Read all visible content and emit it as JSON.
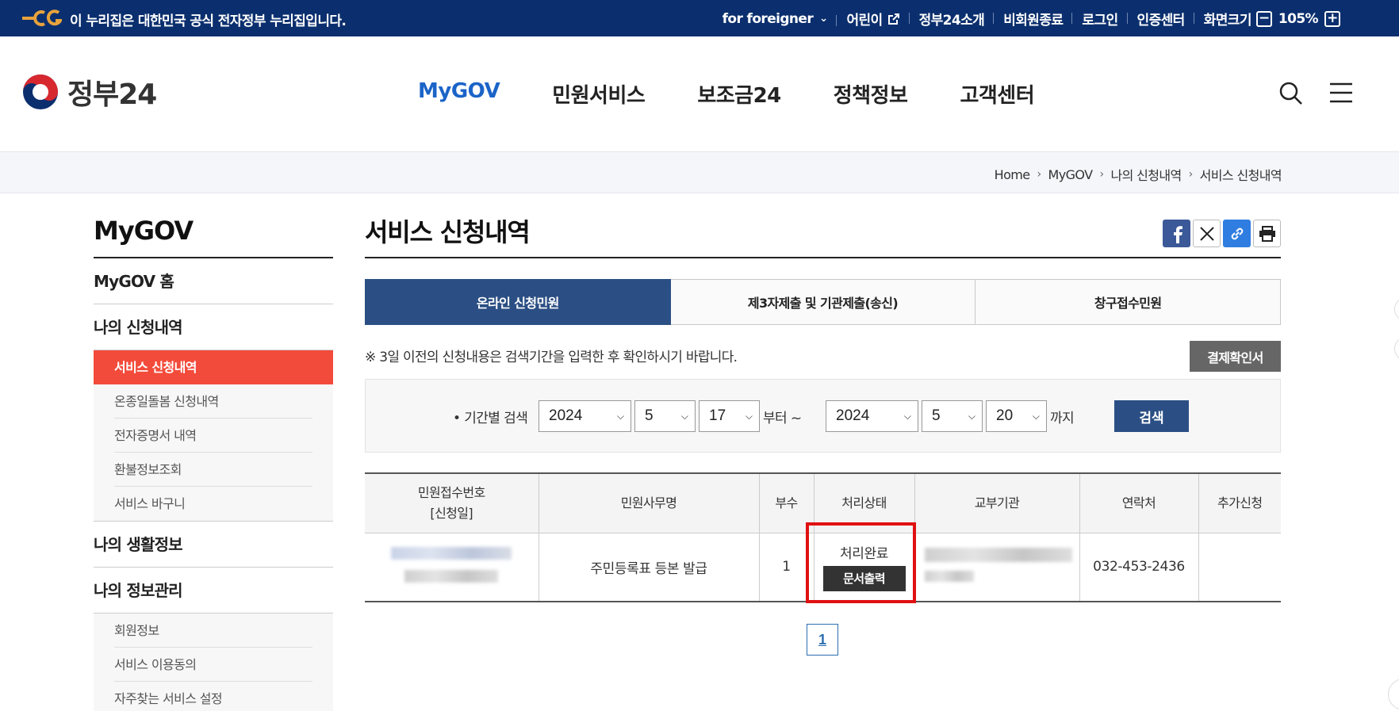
{
  "banner": {
    "notice": "이 누리집은 대한민국 공식 전자정부 누리집입니다.",
    "links": {
      "foreigner": "for foreigner",
      "kids": "어린이",
      "about": "정부24소개",
      "guest_exit": "비회원종료",
      "login": "로그인",
      "cert_center": "인증센터",
      "font_size": "화면크기",
      "zoom_minus": "−",
      "zoom_value": "105%",
      "zoom_plus": "+"
    }
  },
  "header": {
    "logo_name": "정부24",
    "nav": [
      "MyGOV",
      "민원서비스",
      "보조금24",
      "정책정보",
      "고객센터"
    ],
    "active_nav": "MyGOV"
  },
  "breadcrumb": [
    "Home",
    "MyGOV",
    "나의 신청내역",
    "서비스 신청내역"
  ],
  "sidebar": {
    "title": "MyGOV",
    "home": "MyGOV 홈",
    "my_apps": "나의 신청내역",
    "my_apps_items": [
      "서비스 신청내역",
      "온종일돌봄 신청내역",
      "전자증명서 내역",
      "환불정보조회",
      "서비스 바구니"
    ],
    "life_info": "나의 생활정보",
    "my_info": "나의 정보관리",
    "my_info_items": [
      "회원정보",
      "서비스 이용동의",
      "자주찾는 서비스 설정"
    ]
  },
  "main": {
    "title": "서비스 신청내역",
    "tabs": [
      "온라인 신청민원",
      "제3자제출 및 기관제출(송신)",
      "창구접수민원"
    ],
    "notice": "※ 3일 이전의 신청내용은 검색기간을 입력한 후 확인하시기 바랍니다.",
    "receipt_button": "결제확인서",
    "search": {
      "label": "• 기간별 검색",
      "from_year": "2024",
      "from_month": "5",
      "from_day": "17",
      "from_word": "부터 ~",
      "to_year": "2024",
      "to_month": "5",
      "to_day": "20",
      "to_word": "까지",
      "button": "검색"
    },
    "table": {
      "headers": [
        "민원접수번호",
        "[신청일]",
        "민원사무명",
        "부수",
        "처리상태",
        "교부기관",
        "연락처",
        "추가신청"
      ],
      "rows": [
        {
          "service_name": "주민등록표 등본 발급",
          "copies": "1",
          "status": "처리완료",
          "print_button": "문서출력",
          "contact": "032-453-2436",
          "extra": ""
        }
      ]
    },
    "pagination": [
      "1"
    ]
  },
  "colors": {
    "banner_bg": "#0b2f6e",
    "active_nav": "#1b64c8",
    "tab_active": "#2b4f84",
    "sidebar_active": "#f34b3b",
    "highlight": "#e01010"
  },
  "icons": [
    "chevron-down-icon",
    "external-link-icon",
    "search-icon",
    "hamburger-icon",
    "facebook-icon",
    "x-icon",
    "link-icon",
    "print-icon"
  ]
}
